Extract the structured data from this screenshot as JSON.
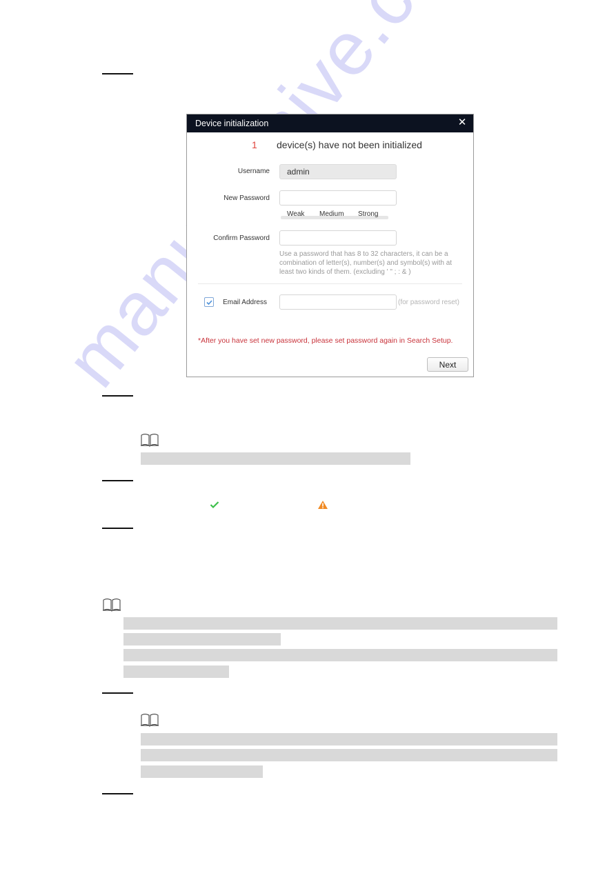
{
  "dialog": {
    "title": "Device initialization",
    "close_icon": "close-icon",
    "uninitialized_count": "1",
    "uninitialized_text": "device(s) have not been initialized",
    "username_label": "Username",
    "username_value": "admin",
    "new_password_label": "New Password",
    "new_password_value": "",
    "strength_levels": [
      "Weak",
      "Medium",
      "Strong"
    ],
    "confirm_password_label": "Confirm Password",
    "confirm_password_value": "",
    "password_hint": "Use a password that has 8 to 32 characters, it can be a combination of letter(s), number(s) and symbol(s) with at least two kinds of them. (excluding ' \" ; : & )",
    "email_checkbox_checked": true,
    "email_label": "Email Address",
    "email_value": "",
    "email_suffix": "(for password reset)",
    "warning_text": "*After you have set new password, please set password again in Search Setup.",
    "next_label": "Next",
    "colors": {
      "header_bg": "#0c1220",
      "count_color": "#e0443c",
      "warning_color": "#c8323a",
      "checkbox_color": "#4a90d9"
    }
  },
  "page": {
    "note_icon": "book-icon",
    "inline_icons": [
      "checkmark-icon",
      "warning-triangle-icon"
    ],
    "inline_icon_colors": {
      "checkmark": "#3cbf4a",
      "warning": "#f08a24"
    },
    "watermark": "manualshive.com"
  }
}
